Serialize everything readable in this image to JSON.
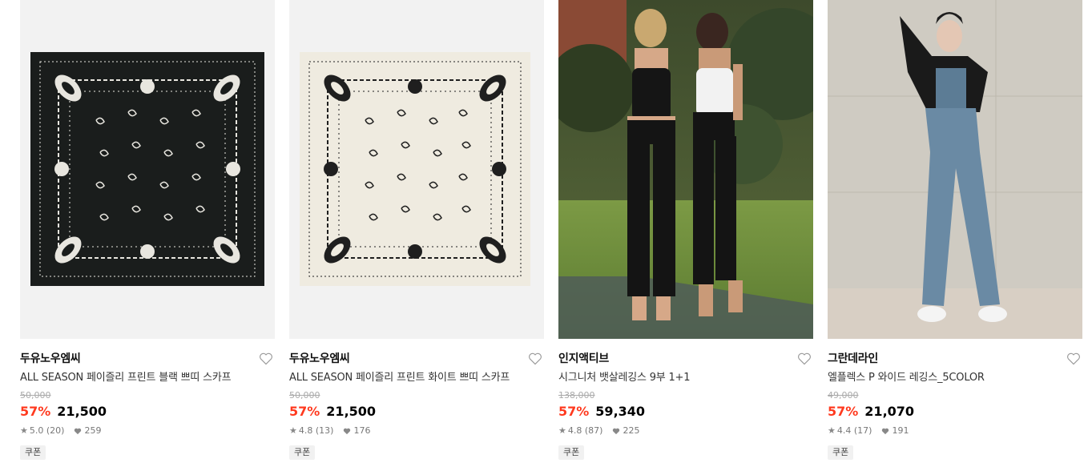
{
  "products": [
    {
      "brand": "두유노우엠씨",
      "name": "ALL SEASON 페이즐리 프린트 블랙 쁘띠 스카프",
      "original_price": "50,000",
      "discount": "57%",
      "price": "21,500",
      "rating": "5.0",
      "reviews": "(20)",
      "likes": "259",
      "coupon": "쿠폰",
      "image": "black-paisley-bandana"
    },
    {
      "brand": "두유노우엠씨",
      "name": "ALL SEASON 페이즐리 프린트 화이트 쁘띠 스카프",
      "original_price": "50,000",
      "discount": "57%",
      "price": "21,500",
      "rating": "4.8",
      "reviews": "(13)",
      "likes": "176",
      "coupon": "쿠폰",
      "image": "white-paisley-bandana"
    },
    {
      "brand": "인지액티브",
      "name": "시그니처 뱃살레깅스 9부 1+1",
      "original_price": "138,000",
      "discount": "57%",
      "price": "59,340",
      "rating": "4.8",
      "reviews": "(87)",
      "likes": "225",
      "coupon": "쿠폰",
      "image": "two-models-black-leggings"
    },
    {
      "brand": "그란데라인",
      "name": "엘플렉스 P 와이드 레깅스_5COLOR",
      "original_price": "49,000",
      "discount": "57%",
      "price": "21,070",
      "rating": "4.4",
      "reviews": "(17)",
      "likes": "191",
      "coupon": "쿠폰",
      "image": "model-blue-wide-leggings"
    }
  ],
  "colors": {
    "discount": "#ff3a1f",
    "strike": "#aaaaaa",
    "coupon_bg": "#f1f1f1"
  }
}
